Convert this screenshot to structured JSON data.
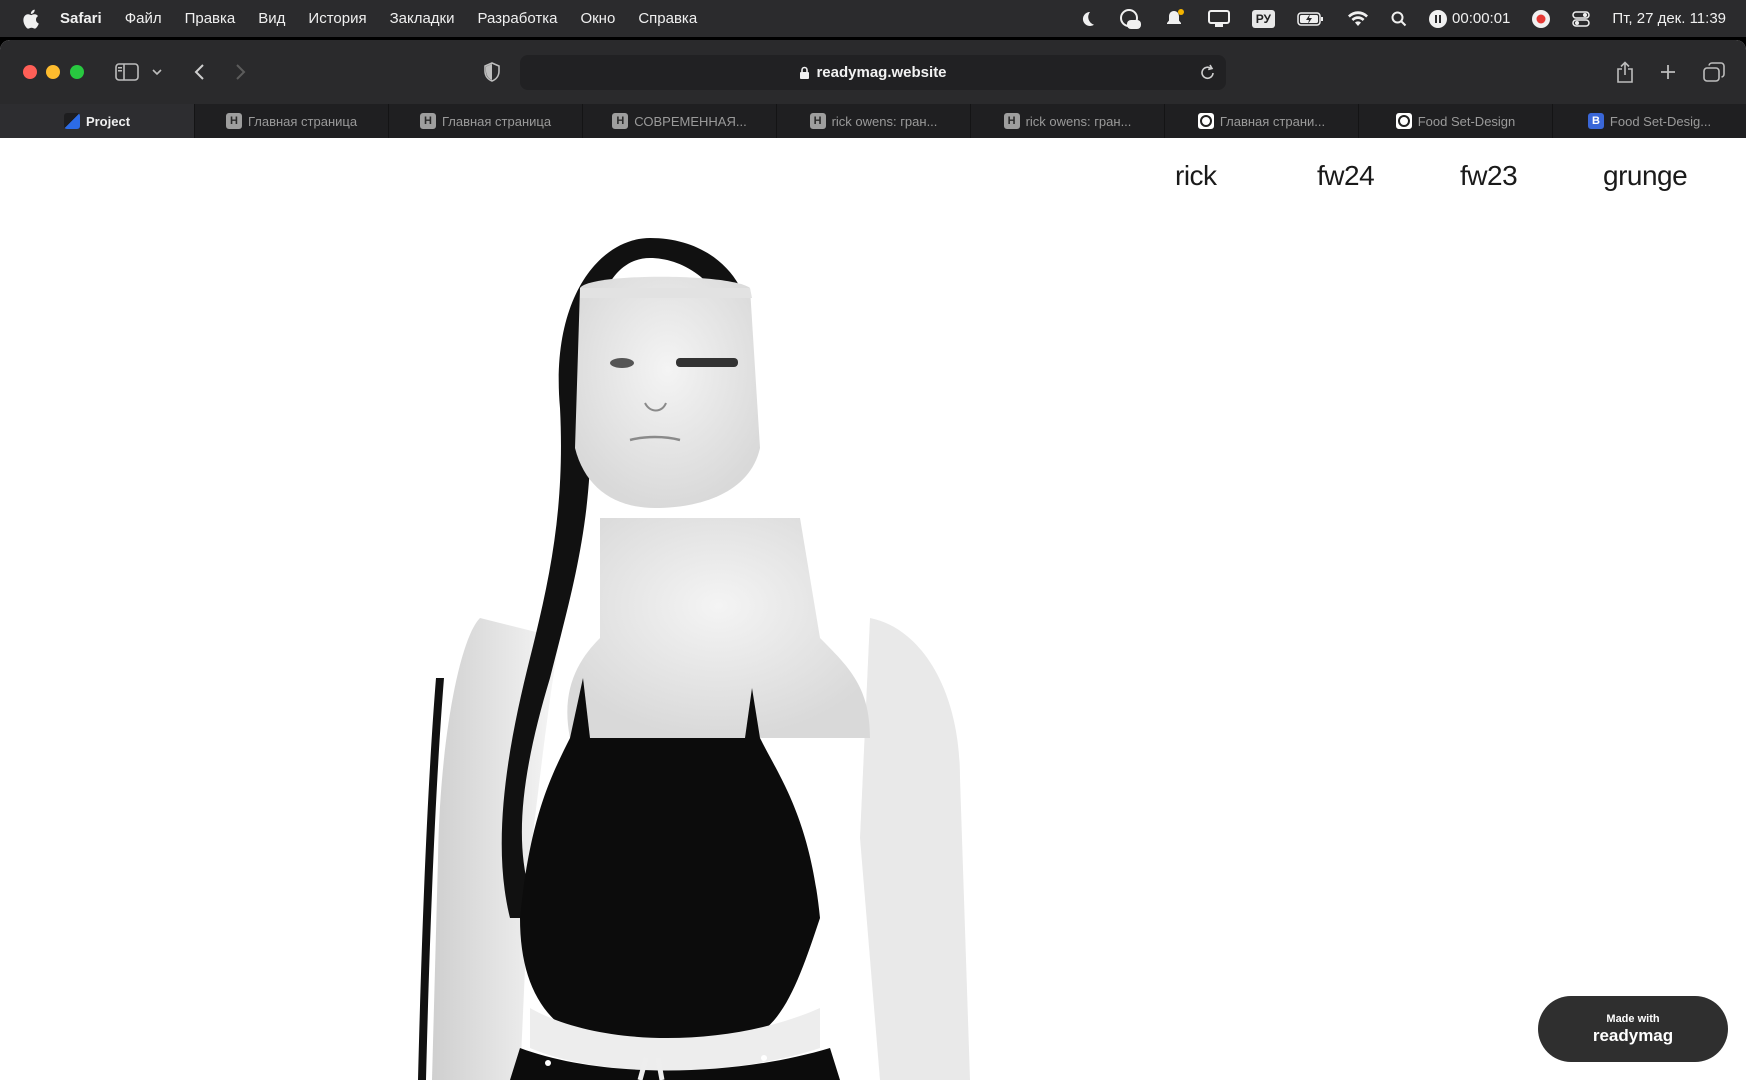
{
  "menubar": {
    "app": "Safari",
    "items": [
      "Файл",
      "Правка",
      "Вид",
      "История",
      "Закладки",
      "Разработка",
      "Окно",
      "Справка"
    ],
    "input_source": "РУ",
    "timer": "00:00:01",
    "datetime": "Пт, 27 дек.  11:39"
  },
  "browser": {
    "address": "readymag.website",
    "tabs": [
      {
        "label": "Project",
        "favicon": "project-icon"
      },
      {
        "label": "Главная страница",
        "favicon": "H"
      },
      {
        "label": "Главная страница",
        "favicon": "H"
      },
      {
        "label": "СОВРЕМЕННАЯ...",
        "favicon": "H"
      },
      {
        "label": "rick owens: гран...",
        "favicon": "H"
      },
      {
        "label": "rick owens: гран...",
        "favicon": "H"
      },
      {
        "label": "Главная страни...",
        "favicon": "circle-icon"
      },
      {
        "label": "Food Set-Design",
        "favicon": "circle-icon"
      },
      {
        "label": "Food Set-Desig...",
        "favicon": "B"
      }
    ]
  },
  "page": {
    "nav": [
      "rick",
      "fw24",
      "fw23",
      "grunge"
    ],
    "badge": {
      "line1": "Made with",
      "line2": "readymag"
    }
  }
}
